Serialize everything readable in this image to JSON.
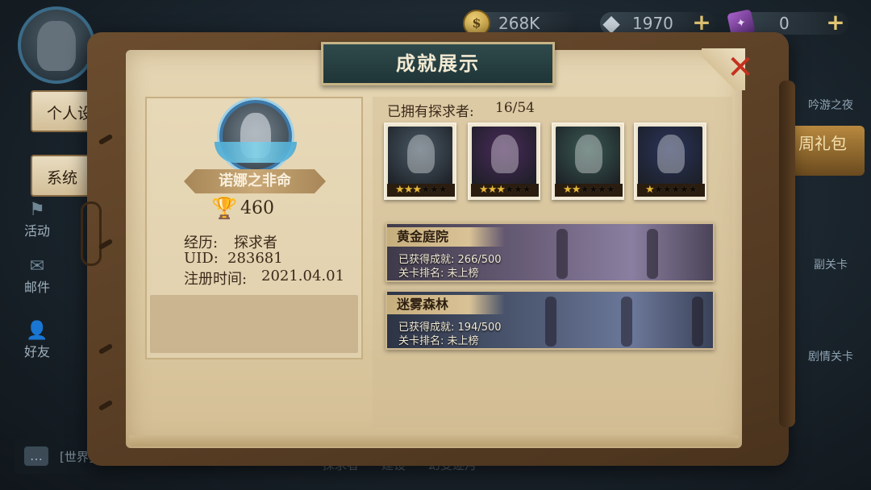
{
  "topbar": {
    "gold": {
      "icon": "gold-coin-icon",
      "value": "268K"
    },
    "diamond": {
      "icon": "diamond-icon",
      "value": "1970"
    },
    "ticket": {
      "icon": "summon-ticket-icon",
      "value": "0"
    }
  },
  "background": {
    "side_tabs": [
      "个人设",
      "系统"
    ],
    "side_icons": [
      "活动",
      "邮件",
      "好友"
    ],
    "chat": {
      "channel": "[世界] 诺娜之非命"
    },
    "bottom_tabs": [
      "探求者",
      "建设",
      "幻变逐月"
    ],
    "right_buttons": [
      "吟游之夜",
      "副关卡",
      "剧情关卡"
    ],
    "gift": "周礼包"
  },
  "panel": {
    "title": "成就展示",
    "profile": {
      "name": "诺娜之非命",
      "trophy_count": "460",
      "experience_label": "经历:",
      "experience_value": "探求者",
      "uid_label": "UID:",
      "uid_value": "283681",
      "register_label": "注册时间:",
      "register_value": "2021.04.01"
    },
    "seekers": {
      "label": "已拥有探求者:",
      "count": "16/54",
      "cards": [
        {
          "name": "seeker-card-1",
          "stars": 3,
          "max_stars": 6,
          "color": "#4a5a66"
        },
        {
          "name": "seeker-card-2",
          "stars": 3,
          "max_stars": 6,
          "color": "#4a2a5a"
        },
        {
          "name": "seeker-card-3",
          "stars": 2,
          "max_stars": 6,
          "color": "#3a5a52"
        },
        {
          "name": "seeker-card-4",
          "stars": 1,
          "max_stars": 6,
          "color": "#2a345a"
        }
      ]
    },
    "achievements": [
      {
        "title": "黄金庭院",
        "earned_label": "已获得成就:",
        "earned_value": "266/500",
        "rank_label": "关卡排名:",
        "rank_value": "未上榜"
      },
      {
        "title": "迷雾森林",
        "earned_label": "已获得成就:",
        "earned_value": "194/500",
        "rank_label": "关卡排名:",
        "rank_value": "未上榜"
      }
    ]
  },
  "colors": {
    "accent_gold": "#e7b83a",
    "close_red": "#c4301f",
    "banner_teal": "#2f4a4c",
    "paper": "#e6d6b3"
  }
}
